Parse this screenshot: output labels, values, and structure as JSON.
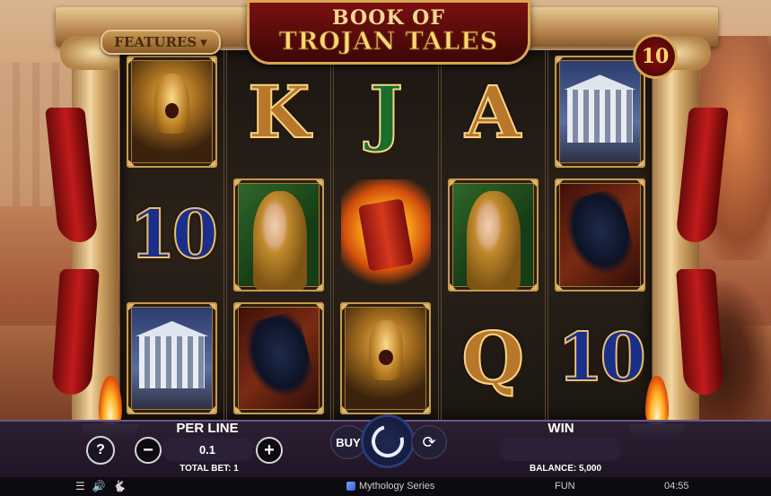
{
  "game": {
    "title_line1": "BOOK OF",
    "title_line2": "TROJAN TALES",
    "features_label": "FEATURES",
    "features_arrow": "▾",
    "lines_count": "10"
  },
  "reels": [
    [
      {
        "symbol": "hero-helmet"
      },
      {
        "symbol": "ten",
        "text": "10"
      },
      {
        "symbol": "temple"
      }
    ],
    [
      {
        "symbol": "king",
        "text": "K"
      },
      {
        "symbol": "maiden"
      },
      {
        "symbol": "trojan-horse"
      }
    ],
    [
      {
        "symbol": "jack",
        "text": "J"
      },
      {
        "symbol": "book-scatter"
      },
      {
        "symbol": "hero-helmet"
      }
    ],
    [
      {
        "symbol": "ace",
        "text": "A"
      },
      {
        "symbol": "maiden"
      },
      {
        "symbol": "queen",
        "text": "Q"
      }
    ],
    [
      {
        "symbol": "temple"
      },
      {
        "symbol": "trojan-horse"
      },
      {
        "symbol": "ten",
        "text": "10"
      }
    ]
  ],
  "controls": {
    "help": "?",
    "minus": "−",
    "plus": "+",
    "per_line_label": "PER LINE",
    "per_line_value": "0.1",
    "total_bet": "TOTAL BET: 1",
    "buy_label": "BUY",
    "autoplay_glyph": "⟳",
    "win_label": "WIN",
    "balance": "BALANCE: 5,000"
  },
  "footer": {
    "menu_glyph": "☰",
    "sound_glyph": "🔊",
    "turbo_glyph": "🐇",
    "brand": "Mythology Series",
    "mode": "FUN",
    "time": "04:55"
  },
  "colors": {
    "accent_gold": "#d8a64e",
    "title_red": "#7a1010",
    "panel": "#261c34"
  }
}
